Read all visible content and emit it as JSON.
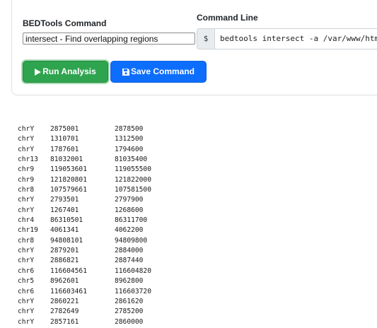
{
  "form": {
    "command_label": "BEDTools Command",
    "command_select_value": "intersect - Find overlapping regions",
    "command_line_label": "Command Line",
    "prefix": "$",
    "command_line_text": "bedtools intersect -a /var/www/html"
  },
  "buttons": {
    "run_label": "Run Analysis",
    "save_label": "Save Command"
  },
  "colors": {
    "run_button": "#2ea44f",
    "save_button": "#0d6efd"
  },
  "icons": {
    "run": "play-icon",
    "save": "floppy-disk-icon"
  },
  "output": {
    "rows": [
      [
        "chrY",
        "2875001",
        "2878500"
      ],
      [
        "chrY",
        "1310701",
        "1312500"
      ],
      [
        "chrY",
        "1787601",
        "1794600"
      ],
      [
        "chr13",
        "81032001",
        "81035400"
      ],
      [
        "chr9",
        "119053601",
        "119055500"
      ],
      [
        "chr9",
        "121820801",
        "121822000"
      ],
      [
        "chr8",
        "107579661",
        "107581500"
      ],
      [
        "chrY",
        "2793501",
        "2797900"
      ],
      [
        "chrY",
        "1267401",
        "1268600"
      ],
      [
        "chr4",
        "86310501",
        "86311700"
      ],
      [
        "chr19",
        "4061341",
        "4062200"
      ],
      [
        "chr8",
        "94808101",
        "94809800"
      ],
      [
        "chrY",
        "2879201",
        "2884000"
      ],
      [
        "chrY",
        "2886821",
        "2887440"
      ],
      [
        "chr6",
        "116604561",
        "116604820"
      ],
      [
        "chr5",
        "8962601",
        "8962800"
      ],
      [
        "chr6",
        "116603461",
        "116603720"
      ],
      [
        "chrY",
        "2860221",
        "2861620"
      ],
      [
        "chrY",
        "2782649",
        "2785200"
      ],
      [
        "chrY",
        "2857161",
        "2860000"
      ]
    ]
  }
}
